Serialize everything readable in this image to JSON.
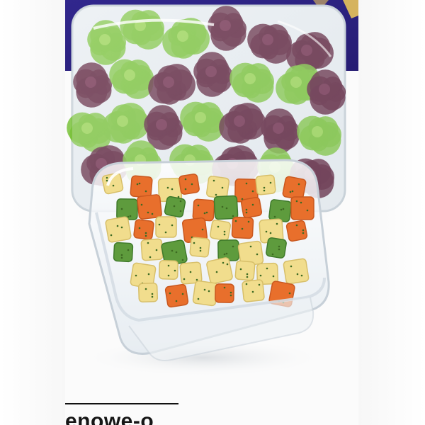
{
  "image": {
    "subject": "salad-container-photo",
    "colors": {
      "banner": "#2f2486",
      "lettuce_green": "#79c23a",
      "lettuce_red": "#5a1f3a",
      "carrot": "#e86f2c",
      "potato": "#f1dd8d",
      "cucumber": "#5e9b3d",
      "plastic": "#e9eef3"
    }
  },
  "caption": {
    "text": "enowe-o"
  }
}
